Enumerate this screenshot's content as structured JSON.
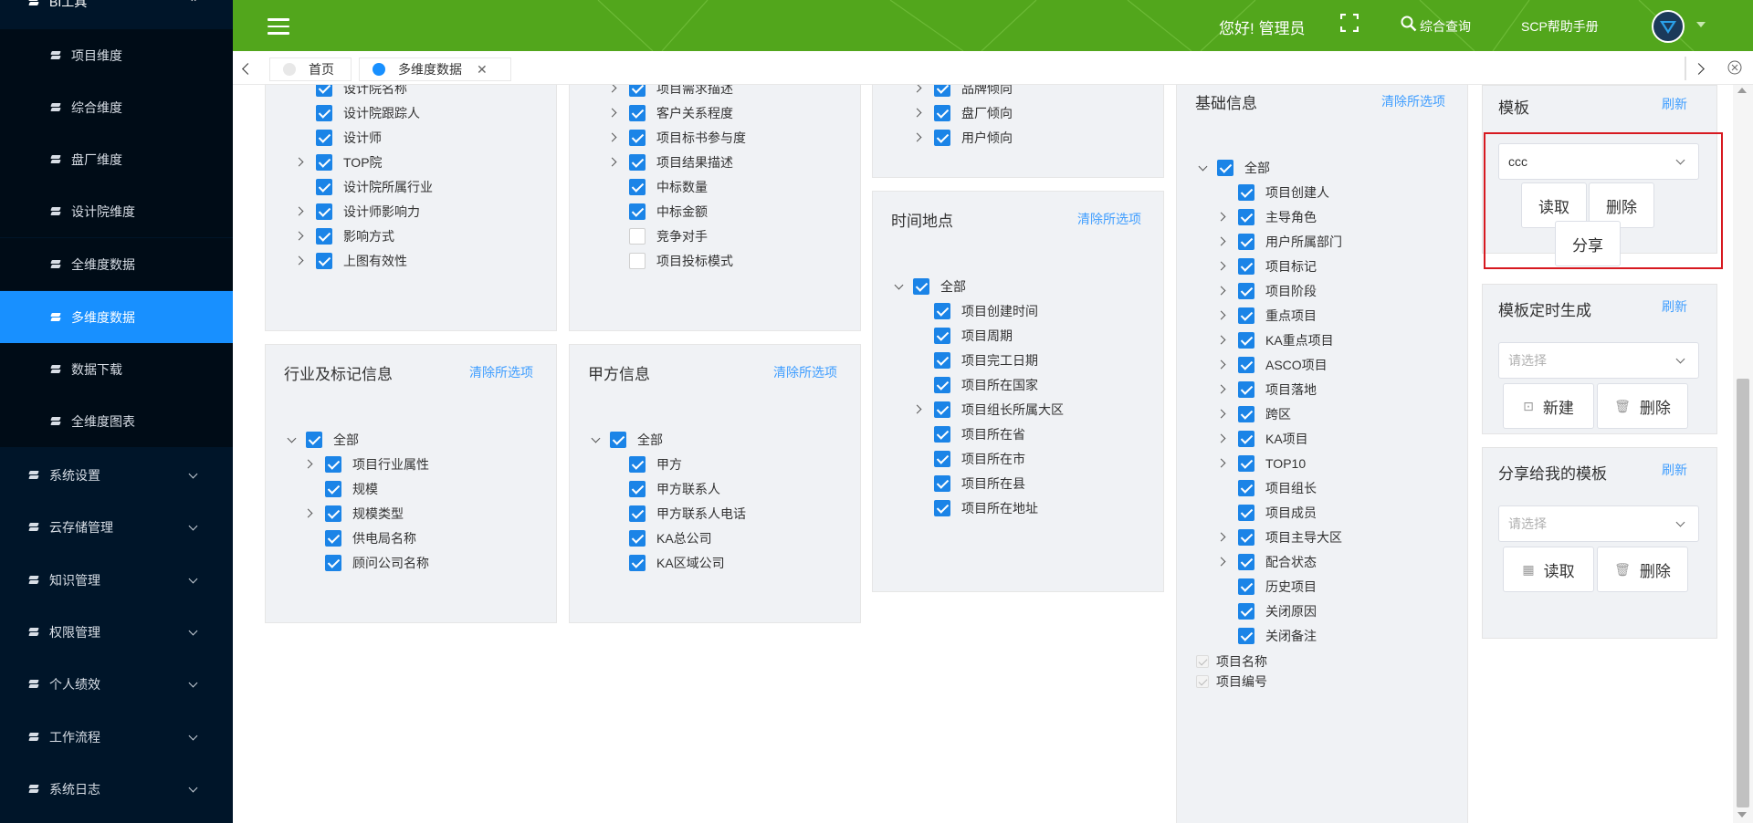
{
  "sidebar": {
    "section_title": "BI工具",
    "sub_items": [
      "项目维度",
      "综合维度",
      "盘厂维度",
      "设计院维度",
      "全维度数据",
      "多维度数据",
      "数据下载",
      "全维度图表"
    ],
    "top_items": [
      "系统设置",
      "云存储管理",
      "知识管理",
      "权限管理",
      "个人绩效",
      "工作流程",
      "系统日志"
    ]
  },
  "header": {
    "greeting": "您好! 管理员",
    "search_label": "综合查询",
    "help_label": "SCP帮助手册",
    "bg_color": "#52a61c"
  },
  "tabs": [
    {
      "label": "首页"
    },
    {
      "label": "多维度数据"
    }
  ],
  "panels": {
    "p1_partial": {
      "rows": [
        "设计院名称",
        "设计院跟踪人",
        "设计师",
        "TOP院",
        "设计院所属行业",
        "设计师影响力",
        "影响方式",
        "上图有效性"
      ]
    },
    "p2_partial": {
      "rows": [
        "项目需求描述",
        "客户关系程度",
        "项目标书参与度",
        "项目结果描述",
        "中标数量",
        "中标金额",
        "竞争对手",
        "项目投标模式"
      ]
    },
    "p3_partial": {
      "rows": [
        "品牌倾向",
        "盘厂倾向",
        "用户倾向"
      ]
    },
    "industry": {
      "title": "行业及标记信息",
      "clear": "清除所选项",
      "all": "全部",
      "rows": [
        "项目行业属性",
        "规模",
        "规模类型",
        "供电局名称",
        "顾问公司名称"
      ]
    },
    "party_a": {
      "title": "甲方信息",
      "clear": "清除所选项",
      "all": "全部",
      "rows": [
        "甲方",
        "甲方联系人",
        "甲方联系人电话",
        "KA总公司",
        "KA区域公司"
      ]
    },
    "time_place": {
      "title": "时间地点",
      "clear": "清除所选项",
      "all": "全部",
      "rows": [
        "项目创建时间",
        "项目周期",
        "项目完工日期",
        "项目所在国家",
        "项目组长所属大区",
        "项目所在省",
        "项目所在市",
        "项目所在县",
        "项目所在地址"
      ]
    },
    "basic": {
      "title": "基础信息",
      "clear": "清除所选项",
      "all": "全部",
      "rows": [
        "项目创建人",
        "主导角色",
        "用户所属部门",
        "项目标记",
        "项目阶段",
        "重点项目",
        "KA重点项目",
        "ASCO项目",
        "项目落地",
        "跨区",
        "KA项目",
        "TOP10",
        "项目组长",
        "项目成员",
        "项目主导大区",
        "配合状态",
        "历史项目",
        "关闭原因",
        "关闭备注"
      ],
      "fixed": [
        "项目名称",
        "项目编号"
      ]
    }
  },
  "right": {
    "template": {
      "title": "模板",
      "refresh": "刷新",
      "selected": "ccc",
      "read": "读取",
      "delete": "删除",
      "share": "分享"
    },
    "scheduled": {
      "title": "模板定时生成",
      "refresh": "刷新",
      "placeholder": "请选择",
      "new": "新建",
      "delete": "删除"
    },
    "shared": {
      "title": "分享给我的模板",
      "refresh": "刷新",
      "placeholder": "请选择",
      "read": "读取",
      "delete": "删除"
    }
  }
}
